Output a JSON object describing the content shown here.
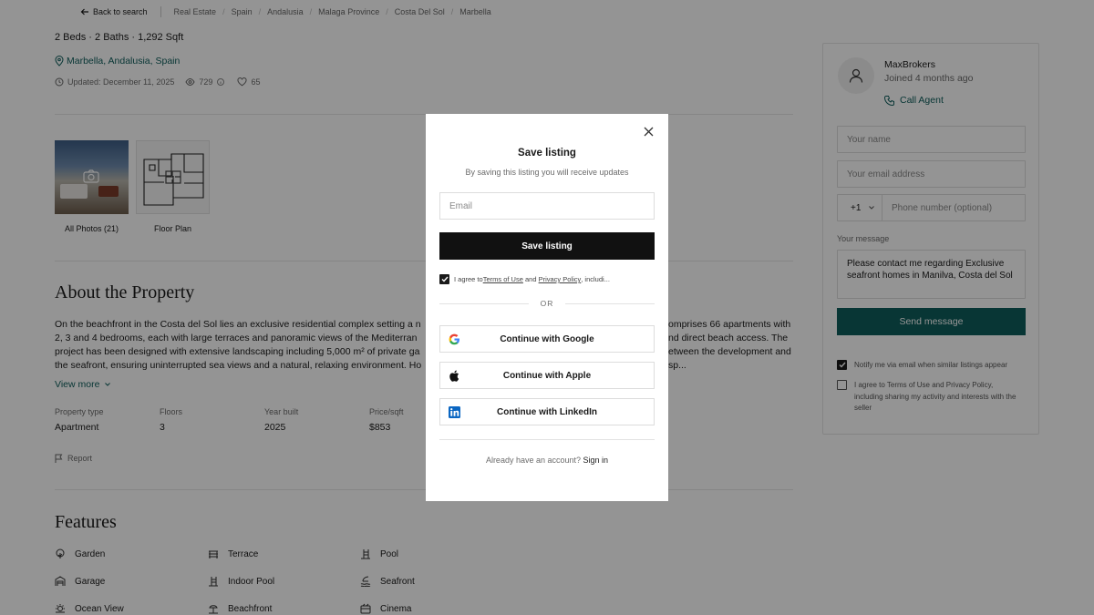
{
  "breadcrumb": {
    "back": "Back to search",
    "items": [
      "Real Estate",
      "Spain",
      "Andalusia",
      "Malaga Province",
      "Costa Del Sol",
      "Marbella"
    ]
  },
  "listing": {
    "specs": "2 Beds · 2 Baths · 1,292 Sqft",
    "location": "Marbella, Andalusia, Spain",
    "updated": "Updated: December 11, 2025",
    "views": "729",
    "likes": "65",
    "photos_label": "All Photos (21)",
    "floorplan_label": "Floor Plan"
  },
  "about": {
    "title": "About the Property",
    "lines": [
      "On the beachfront in the Costa del Sol lies an exclusive residential complex setting a n",
      "2, 3 and 4 bedrooms, each with large terraces and panoramic views of the Mediterran",
      "project has been designed with extensive landscaping including 5,000 m² of private ga",
      "the seafront, ensuring uninterrupted sea views and a natural, relaxing environment. Ho"
    ],
    "lines_right": [
      "omprises 66 apartments with",
      "nd direct beach access. The",
      "etween the development and",
      "sp..."
    ],
    "view_more": "View more",
    "facts": [
      {
        "label": "Property type",
        "value": "Apartment"
      },
      {
        "label": "Floors",
        "value": "3"
      },
      {
        "label": "Year built",
        "value": "2025"
      },
      {
        "label": "Price/sqft",
        "value": "$853"
      }
    ],
    "report": "Report"
  },
  "features": {
    "title": "Features",
    "items": [
      {
        "label": "Garden",
        "icon": "garden-icon"
      },
      {
        "label": "Terrace",
        "icon": "terrace-icon"
      },
      {
        "label": "Pool",
        "icon": "pool-icon"
      },
      {
        "label": "Garage",
        "icon": "garage-icon"
      },
      {
        "label": "Indoor Pool",
        "icon": "indoor-pool-icon"
      },
      {
        "label": "Seafront",
        "icon": "seafront-icon"
      },
      {
        "label": "Ocean View",
        "icon": "ocean-view-icon"
      },
      {
        "label": "Beachfront",
        "icon": "beachfront-icon"
      },
      {
        "label": "Cinema",
        "icon": "cinema-icon"
      }
    ]
  },
  "agent": {
    "name": "MaxBrokers",
    "joined": "Joined 4 months ago",
    "call": "Call Agent",
    "name_placeholder": "Your name",
    "email_placeholder": "Your email address",
    "country_code": "+1",
    "phone_placeholder": "Phone number (optional)",
    "message_label": "Your message",
    "message": "Please contact me regarding Exclusive seafront homes in Manilva, Costa del Sol",
    "send": "Send message",
    "notify": "Notify me via email when similar listings appear",
    "agree": "I agree to Terms of Use and Privacy Policy, including sharing my activity and interests with the seller"
  },
  "modal": {
    "title": "Save listing",
    "subtitle": "By saving this listing you will receive updates",
    "email_placeholder": "Email",
    "save": "Save listing",
    "agree_prefix": "I agree to ",
    "terms": "Terms of Use",
    "and": " and ",
    "privacy": "Privacy Policy",
    "agree_suffix": ", includi...",
    "or": "OR",
    "google": "Continue with Google",
    "apple": "Continue with Apple",
    "linkedin": "Continue with LinkedIn",
    "have_account": "Already have an account?",
    "sign_in": "Sign in"
  },
  "colors": {
    "accent": "#0f5e5c",
    "link": "#0f5e5c",
    "dark_button": "#111111",
    "overlay": "rgba(0,0,0,0.42)"
  }
}
